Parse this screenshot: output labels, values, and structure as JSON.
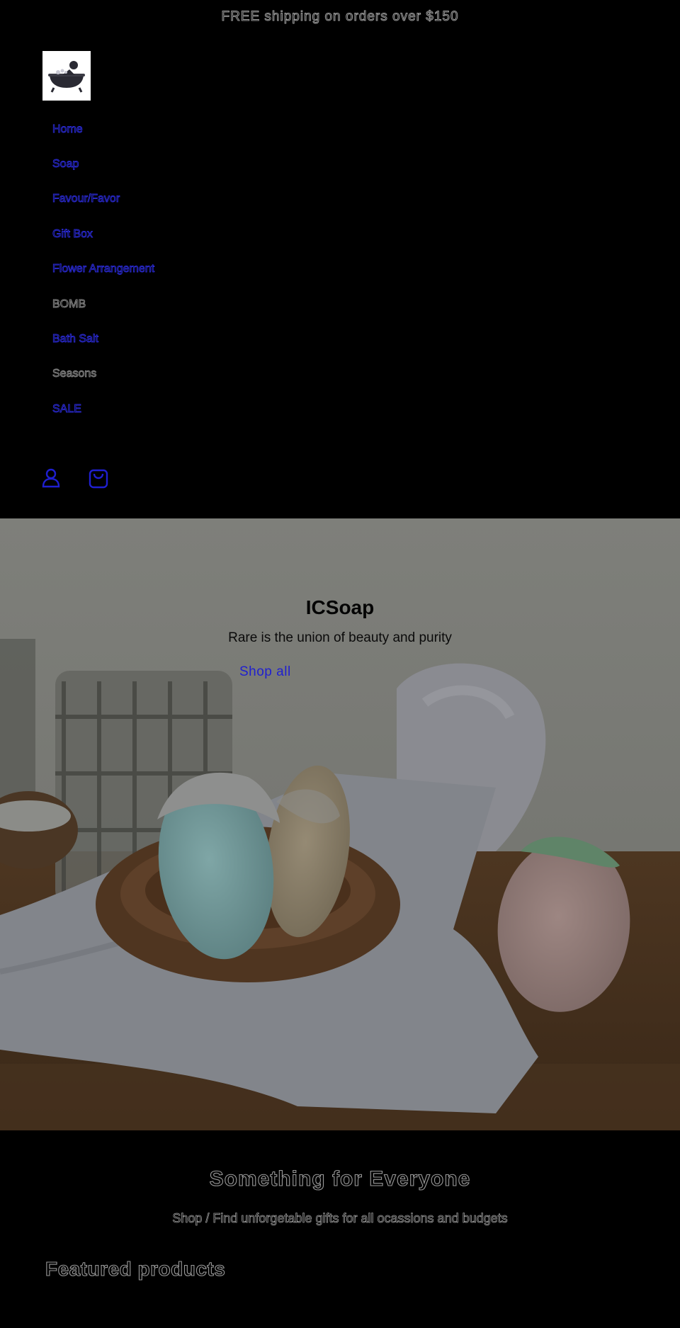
{
  "announcement": {
    "text": "FREE shipping on orders over $150"
  },
  "logo": {
    "icon": "bathtub-logo-icon"
  },
  "nav": {
    "items": [
      {
        "label": "Home",
        "link": true
      },
      {
        "label": "Soap",
        "link": true
      },
      {
        "label": "Favour/Favor",
        "link": true
      },
      {
        "label": "Gift Box",
        "link": true
      },
      {
        "label": "Flower Arrangement",
        "link": true
      },
      {
        "label": "BOMB",
        "link": false
      },
      {
        "label": "Bath Salt",
        "link": true
      },
      {
        "label": "Seasons",
        "link": false
      },
      {
        "label": "SALE",
        "link": true
      }
    ]
  },
  "header_icons": {
    "account": "account-icon",
    "cart": "cart-icon"
  },
  "hero": {
    "title": "ICSoap",
    "subtitle": "Rare is the union of beauty and purity",
    "button": "Shop all"
  },
  "collection": {
    "title": "Something for Everyone",
    "subtitle": "Shop / Find unforgetable gifts for all ocassions and budgets"
  },
  "featured": {
    "title": "Featured products"
  },
  "colors": {
    "link": "#2b2bd8",
    "background": "#000000"
  }
}
